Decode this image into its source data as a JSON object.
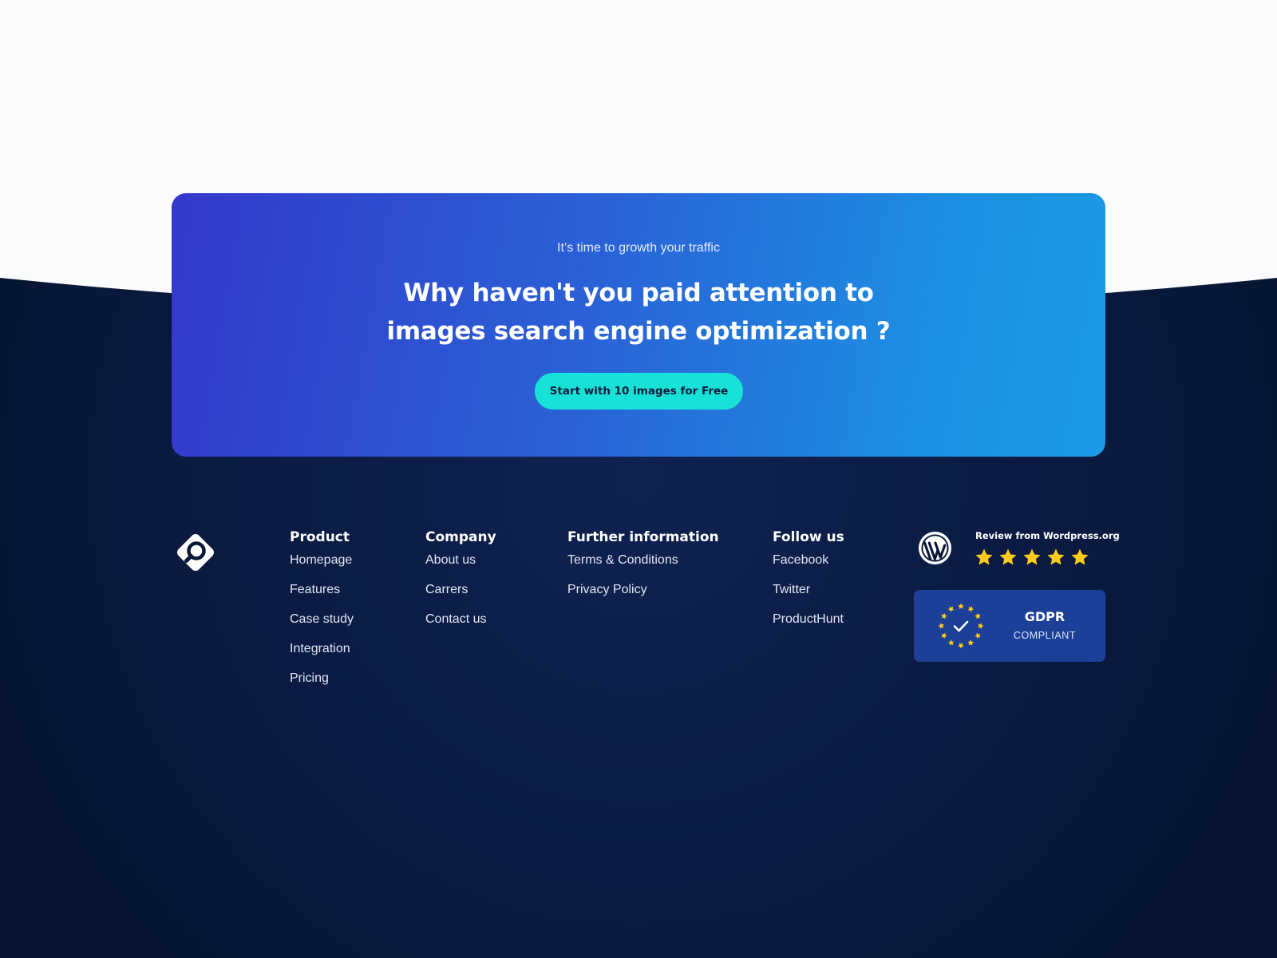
{
  "cta": {
    "eyebrow": "It’s time to growth your traffic",
    "headline_line1": "Why haven't you paid attention to",
    "headline_line2": "images search engine optimization ?",
    "button_label": "Start with 10 images for Free"
  },
  "footer": {
    "columns": [
      {
        "title": "Product",
        "links": [
          "Homepage",
          "Features",
          "Case study",
          "Integration",
          "Pricing"
        ]
      },
      {
        "title": "Company",
        "links": [
          "About us",
          "Carrers",
          "Contact us"
        ]
      },
      {
        "title": "Further information",
        "links": [
          "Terms & Conditions",
          "Privacy Policy"
        ]
      },
      {
        "title": "Follow us",
        "links": [
          "Facebook",
          "Twitter",
          "ProductHunt"
        ]
      }
    ],
    "review": {
      "label": "Review from Wordpress.org",
      "rating": 5,
      "max_rating": 5
    },
    "gdpr": {
      "title": "GDPR",
      "subtitle": "COMPLIANT"
    }
  },
  "colors": {
    "page_bg": "#fafbfd",
    "footer_bg": "#0a1638",
    "cta_gradient_start": "#3438cc",
    "cta_gradient_end": "#1a9be6",
    "button_bg": "#18e2d8",
    "star": "#ffcc1a",
    "gdpr_bg": "#1c3f98"
  },
  "icons": [
    "logo-icon",
    "wordpress-icon",
    "star-icon",
    "eu-stars-icon",
    "checkmark-icon"
  ]
}
